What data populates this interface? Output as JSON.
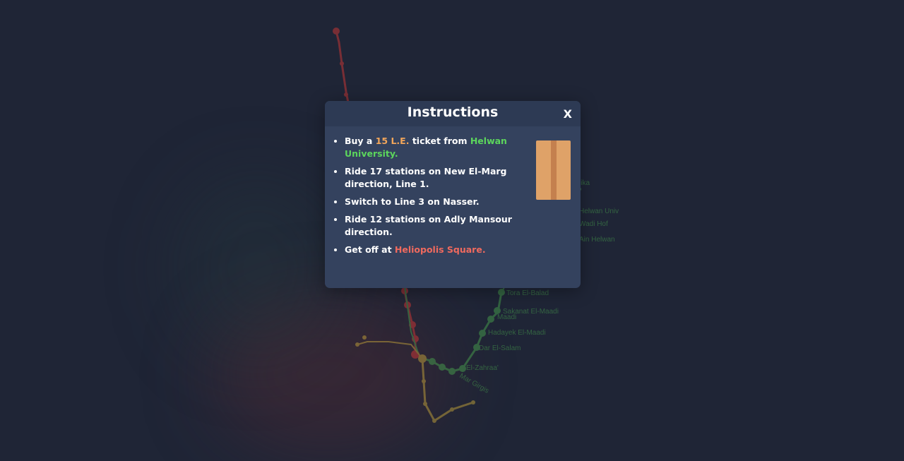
{
  "modal": {
    "title": "Instructions",
    "close_label": "X",
    "steps": [
      {
        "pre": "Buy a ",
        "highlight1": "15 L.E.",
        "mid": " ticket from ",
        "highlight2": "Helwan University."
      },
      {
        "text": "Ride 17 stations on New El-Marg direction, Line 1."
      },
      {
        "text": "Switch to Line 3 on Nasser."
      },
      {
        "text": "Ride 12 stations on Adly Mansour direction."
      },
      {
        "pre": "Get off at ",
        "highlight": "Heliopolis Square."
      }
    ],
    "ticket_icon": "metro-ticket-icon"
  },
  "map": {
    "labels": [
      "Tora El-Balad",
      "Kozzika",
      "Hadayek El-Maadi",
      "Dar El-Salam",
      "El-Zahraa'",
      "Mar Girgis",
      "Sakanat El-Maadi",
      "Maadi",
      "Helwan Univ",
      "Ain Helwan",
      "Wadi Hof"
    ]
  },
  "colors": {
    "background": "#1f2536",
    "modal_bg": "#34425e",
    "modal_header_bg": "#2d3a54",
    "line1": "#4caf50",
    "line2": "#e53935",
    "line3": "#ffc107",
    "ticket_price": "#f2a65a",
    "start_station": "#5cd65c",
    "end_station": "#f06a5e"
  }
}
